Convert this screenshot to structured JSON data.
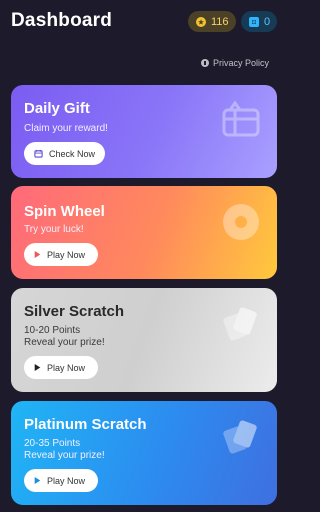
{
  "header": {
    "title": "Dashboard",
    "coins": "116",
    "gems": "0"
  },
  "privacy": {
    "label": "Privacy Policy"
  },
  "cards": {
    "daily": {
      "title": "Daily Gift",
      "subtitle": "Claim your reward!",
      "button": "Check Now",
      "icon": "gift-icon"
    },
    "spin": {
      "title": "Spin Wheel",
      "subtitle": "Try your luck!",
      "button": "Play Now",
      "icon": "wheel-icon"
    },
    "silver": {
      "title": "Silver Scratch",
      "points": "10-20 Points",
      "subtitle": "Reveal your prize!",
      "button": "Play Now",
      "icon": "scratch-card-icon"
    },
    "platinum": {
      "title": "Platinum Scratch",
      "points": "20-35 Points",
      "subtitle": "Reveal your prize!",
      "button": "Play Now",
      "icon": "scratch-card-icon"
    }
  },
  "colors": {
    "background": "#1d1b2b",
    "coin": "#f2c230",
    "gem": "#2fb6ff",
    "daily": "#7b5cf2",
    "spin": "#ff7a6a",
    "silver": "#d6d6d6",
    "platinum": "#1fb5f5"
  }
}
